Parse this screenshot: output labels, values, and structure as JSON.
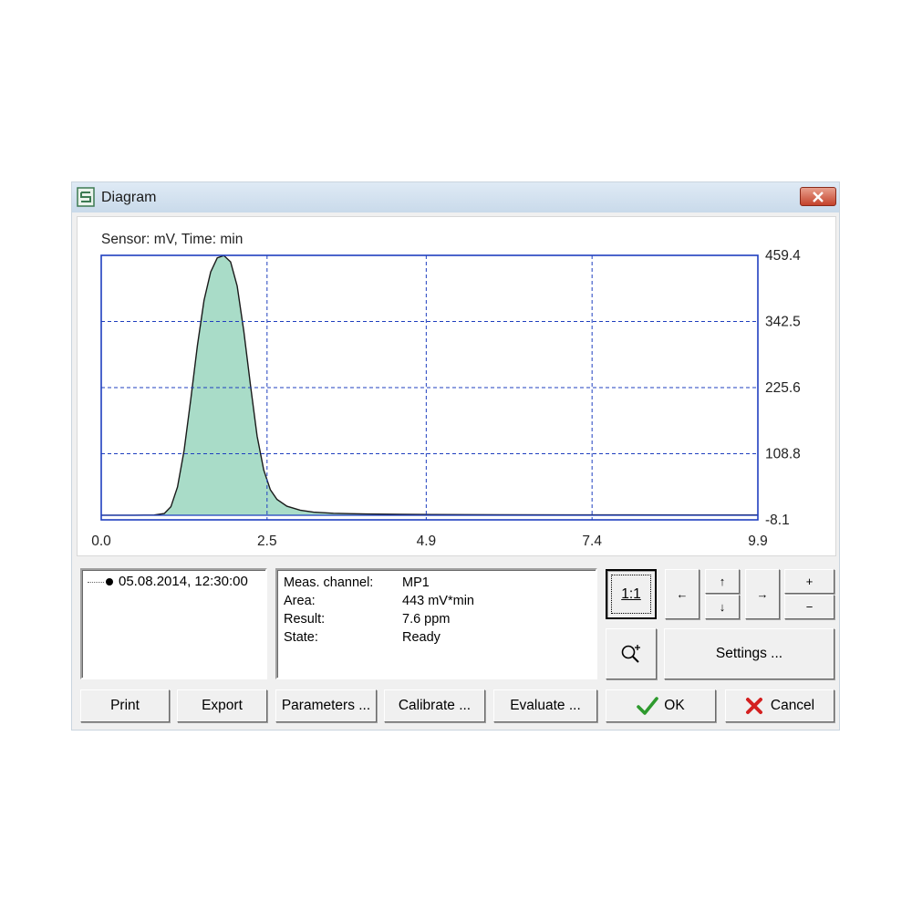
{
  "window": {
    "title": "Diagram",
    "close_label": "×"
  },
  "chart_data": {
    "type": "area",
    "header": "Sensor:  mV,   Time:  min",
    "x_ticks": [
      "0.0",
      "2.5",
      "4.9",
      "7.4",
      "9.9"
    ],
    "y_ticks": [
      "459.4",
      "342.5",
      "225.6",
      "108.8",
      "-8.1"
    ],
    "xlim": [
      0,
      9.9
    ],
    "ylim": [
      -8.1,
      459.4
    ],
    "grid": true,
    "fill_color": "#a9dcc8",
    "line_color": "#1a1a1a",
    "axis_color": "#1f3fbf",
    "x": [
      0,
      0.5,
      0.8,
      0.95,
      1.05,
      1.15,
      1.25,
      1.35,
      1.45,
      1.55,
      1.65,
      1.75,
      1.85,
      1.95,
      2.05,
      2.15,
      2.25,
      2.35,
      2.45,
      2.55,
      2.65,
      2.8,
      3.0,
      3.2,
      3.5,
      4.0,
      4.5,
      5.0,
      6.0,
      7.0,
      8.0,
      9.0,
      9.9
    ],
    "values": [
      0,
      0,
      0.5,
      3,
      15,
      50,
      115,
      205,
      300,
      380,
      430,
      455,
      459,
      448,
      405,
      325,
      230,
      140,
      80,
      45,
      28,
      16,
      9,
      5.5,
      3.5,
      2.2,
      1.6,
      1.2,
      0.9,
      0.7,
      0.6,
      0.5,
      0.4
    ]
  },
  "measurements": {
    "date_item": "05.08.2014, 12:30:00",
    "rows": [
      {
        "label": "Meas. channel:",
        "value": "MP1"
      },
      {
        "label": "Area:",
        "value": "443 mV*min"
      },
      {
        "label": "Result:",
        "value": "7.6 ppm"
      },
      {
        "label": "State:",
        "value": "Ready"
      }
    ]
  },
  "buttons": {
    "print": "Print",
    "export": "Export",
    "parameters": "Parameters ...",
    "calibrate": "Calibrate ...",
    "evaluate": "Evaluate ...",
    "ok": "OK",
    "cancel": "Cancel",
    "settings": "Settings ...",
    "zoom_reset": "1:1",
    "left": "←",
    "right": "→",
    "up": "↑",
    "down": "↓",
    "plus": "+",
    "minus": "−"
  }
}
